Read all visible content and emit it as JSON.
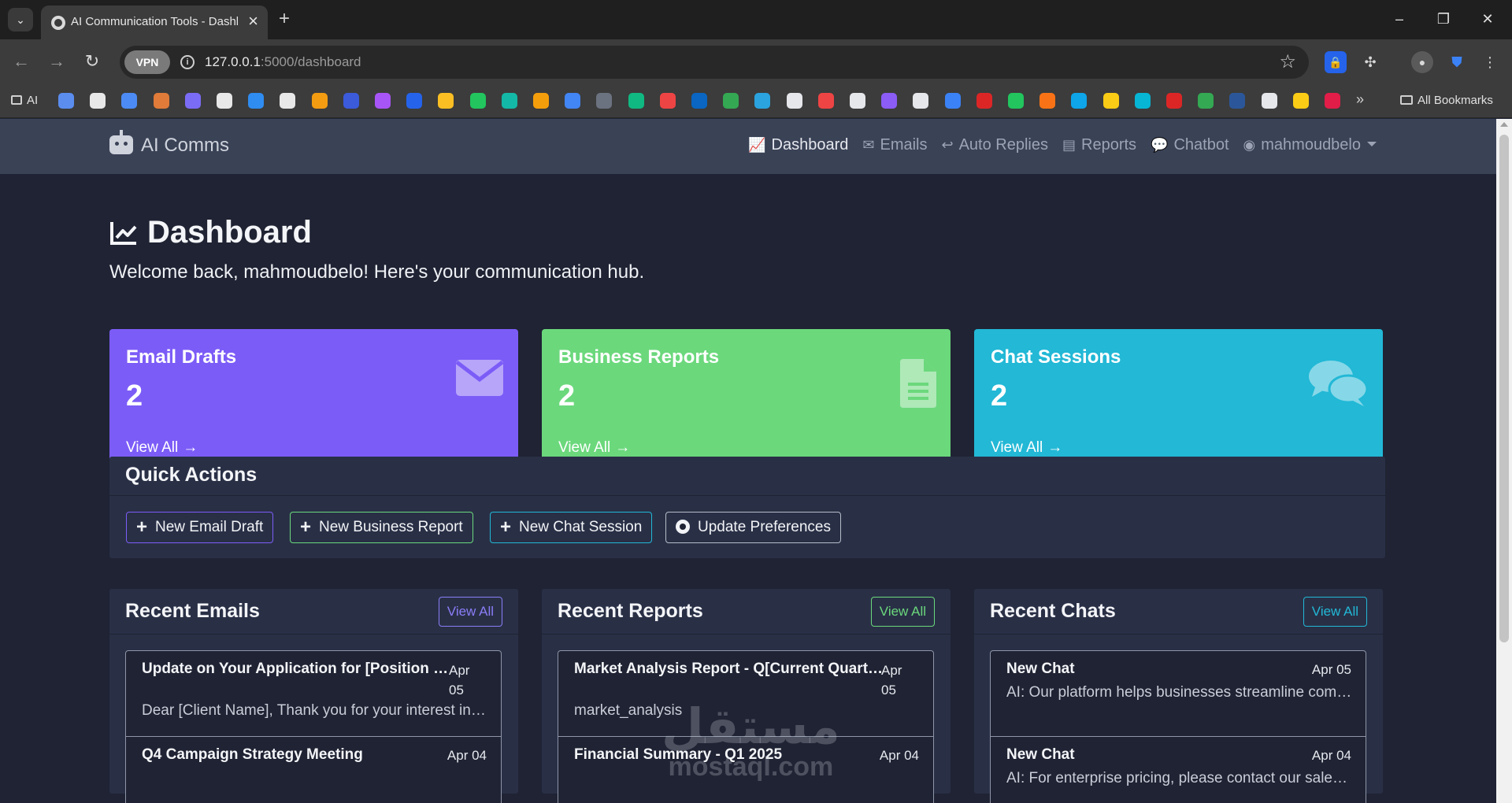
{
  "browser": {
    "tab_title": "AI Communication Tools - Dashboard",
    "url_host": "127.0.0.1",
    "url_path": ":5000/dashboard",
    "vpn_label": "VPN",
    "bookmark_folder": "AI",
    "all_bookmarks": "All Bookmarks",
    "bookmark_colors": [
      "#5b8def",
      "#e8e8e8",
      "#4c8bf5",
      "#e07b39",
      "#7b6cf6",
      "#e8e8e8",
      "#2f8cf0",
      "#e8e8e8",
      "#f39c12",
      "#3b5bdb",
      "#a855f7",
      "#2563eb",
      "#fbbf24",
      "#22c55e",
      "#14b8a6",
      "#f59e0b",
      "#4285f4",
      "#6b7280",
      "#10b981",
      "#ef4444",
      "#0a66c2",
      "#34a853",
      "#2aa3df",
      "#e5e7eb",
      "#ef4444",
      "#e5e7eb",
      "#8b5cf6",
      "#e5e7eb",
      "#3b82f6",
      "#dc2626",
      "#22c55e",
      "#f97316",
      "#0ea5e9",
      "#facc15",
      "#06b6d4",
      "#dc2626",
      "#34a853",
      "#2b579a",
      "#e5e7eb",
      "#facc15",
      "#e11d48"
    ]
  },
  "navbar": {
    "brand": "AI Comms",
    "links": [
      {
        "icon": "chart-line-icon",
        "glyph": "📈",
        "label": "Dashboard",
        "active": true
      },
      {
        "icon": "envelope-icon",
        "glyph": "✉",
        "label": "Emails"
      },
      {
        "icon": "reply-icon",
        "glyph": "↩",
        "label": "Auto Replies"
      },
      {
        "icon": "file-icon",
        "glyph": "▤",
        "label": "Reports"
      },
      {
        "icon": "comments-icon",
        "glyph": "💬",
        "label": "Chatbot"
      },
      {
        "icon": "user-circle-icon",
        "glyph": "◉",
        "label": "mahmoudbelo"
      }
    ]
  },
  "header": {
    "title": "Dashboard",
    "subtitle": "Welcome back, mahmoudbelo! Here's your communication hub."
  },
  "stats": [
    {
      "title": "Email Drafts",
      "count": "2",
      "link": "View All",
      "color": "#7c5cf7",
      "icon": "envelope-icon"
    },
    {
      "title": "Business Reports",
      "count": "2",
      "link": "View All",
      "color": "#6bd87c",
      "icon": "file-alt-icon"
    },
    {
      "title": "Chat Sessions",
      "count": "2",
      "link": "View All",
      "color": "#22b8d6",
      "icon": "comments-icon"
    }
  ],
  "quick_actions": {
    "title": "Quick Actions",
    "buttons": [
      {
        "label": "New Email Draft",
        "color": "#7c5cf7"
      },
      {
        "label": "New Business Report",
        "color": "#6bd87c"
      },
      {
        "label": "New Chat Session",
        "color": "#22b8d6"
      },
      {
        "label": "Update Preferences",
        "color": "#b6bcc8"
      }
    ]
  },
  "recent": [
    {
      "title": "Recent Emails",
      "view_all": "View All",
      "accent": "#8b7cf7",
      "items": [
        {
          "title": "Update on Your Application for [Position Title]",
          "date": "Apr 05",
          "snippet": "Dear [Client Name], Thank you for your interest in our services"
        },
        {
          "title": "Q4 Campaign Strategy Meeting",
          "date": "Apr 04",
          "snippet": ""
        }
      ]
    },
    {
      "title": "Recent Reports",
      "view_all": "View All",
      "accent": "#6bd87c",
      "items": [
        {
          "title": "Market Analysis Report - Q[Current Quarter]",
          "date": "Apr 05",
          "snippet": "market_analysis"
        },
        {
          "title": "Financial Summary - Q1 2025",
          "date": "Apr 04",
          "snippet": ""
        }
      ]
    },
    {
      "title": "Recent Chats",
      "view_all": "View All",
      "accent": "#22b8d6",
      "items": [
        {
          "title": "New Chat",
          "date": "Apr 05",
          "snippet": "AI: Our platform helps businesses streamline communication"
        },
        {
          "title": "New Chat",
          "date": "Apr 04",
          "snippet": "AI: For enterprise pricing, please contact our sales team"
        }
      ]
    }
  ],
  "watermark": {
    "arabic": "مستقل",
    "latin": "mostaql.com"
  }
}
